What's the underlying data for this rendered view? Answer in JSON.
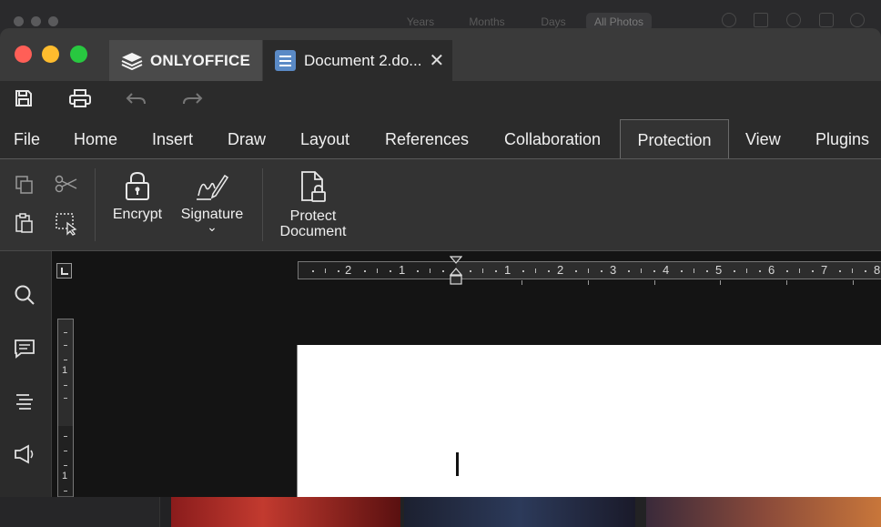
{
  "background_window": {
    "segments": [
      "Years",
      "Months",
      "Days",
      "All Photos"
    ],
    "selected_segment": "All Photos",
    "icons": [
      "info-icon",
      "share-icon",
      "heart-icon",
      "rotate-icon",
      "search-icon"
    ]
  },
  "app": {
    "brand": "ONLYOFFICE",
    "document_tab_title": "Document 2.do...",
    "close_glyph": "✕"
  },
  "quick_access": {
    "icons": [
      "save-icon",
      "print-icon",
      "undo-icon",
      "redo-icon"
    ]
  },
  "menu": {
    "items": [
      "File",
      "Home",
      "Insert",
      "Draw",
      "Layout",
      "References",
      "Collaboration",
      "Protection",
      "View",
      "Plugins"
    ],
    "active": "Protection"
  },
  "toolbar": {
    "encrypt_label": "Encrypt",
    "signature_label": "Signature",
    "signature_arrow": "⌄",
    "protect_label_line1": "Protect",
    "protect_label_line2": "Document"
  },
  "left_rail": {
    "icons": [
      "search-icon",
      "comment-icon",
      "navigation-icon",
      "feedback-icon"
    ]
  },
  "ruler": {
    "labels": [
      "2",
      "1",
      "1",
      "2",
      "3",
      "4",
      "5",
      "6",
      "7",
      "8"
    ],
    "vertical_labels": [
      "1",
      "1"
    ]
  },
  "colors": {
    "accent_doc": "#5a8ac6",
    "close": "#ff5f57",
    "minimize": "#febc2e",
    "zoom": "#28c840"
  }
}
